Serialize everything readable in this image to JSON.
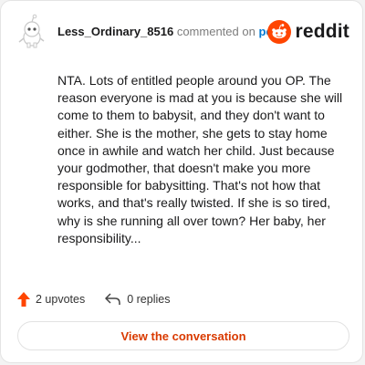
{
  "header": {
    "username": "Less_Ordinary_8516",
    "action_text": "commented on",
    "post_link": "post",
    "brand": "reddit"
  },
  "comment": {
    "text": "NTA. Lots of entitled people around you OP. The reason everyone is mad at you is because she will come to them to babysit, and they don't want to either. She is the mother, she gets to stay home once in awhile and watch her child. Just because your godmother, that doesn't make you more responsible for babysitting. That's not how that works, and that's really twisted. If she is so tired, why is she running all over town? Her baby, her responsibility..."
  },
  "footer": {
    "upvotes": "2 upvotes",
    "replies": "0 replies"
  },
  "cta": {
    "label": "View the conversation"
  },
  "colors": {
    "brand_orange": "#FF4500",
    "link_blue": "#0079D3",
    "cta_text": "#D93A00"
  },
  "icons": {
    "avatar": "snoo-avatar-icon",
    "brand": "reddit-logo-icon",
    "upvote": "upvote-arrow-icon",
    "reply": "reply-arrow-icon"
  }
}
